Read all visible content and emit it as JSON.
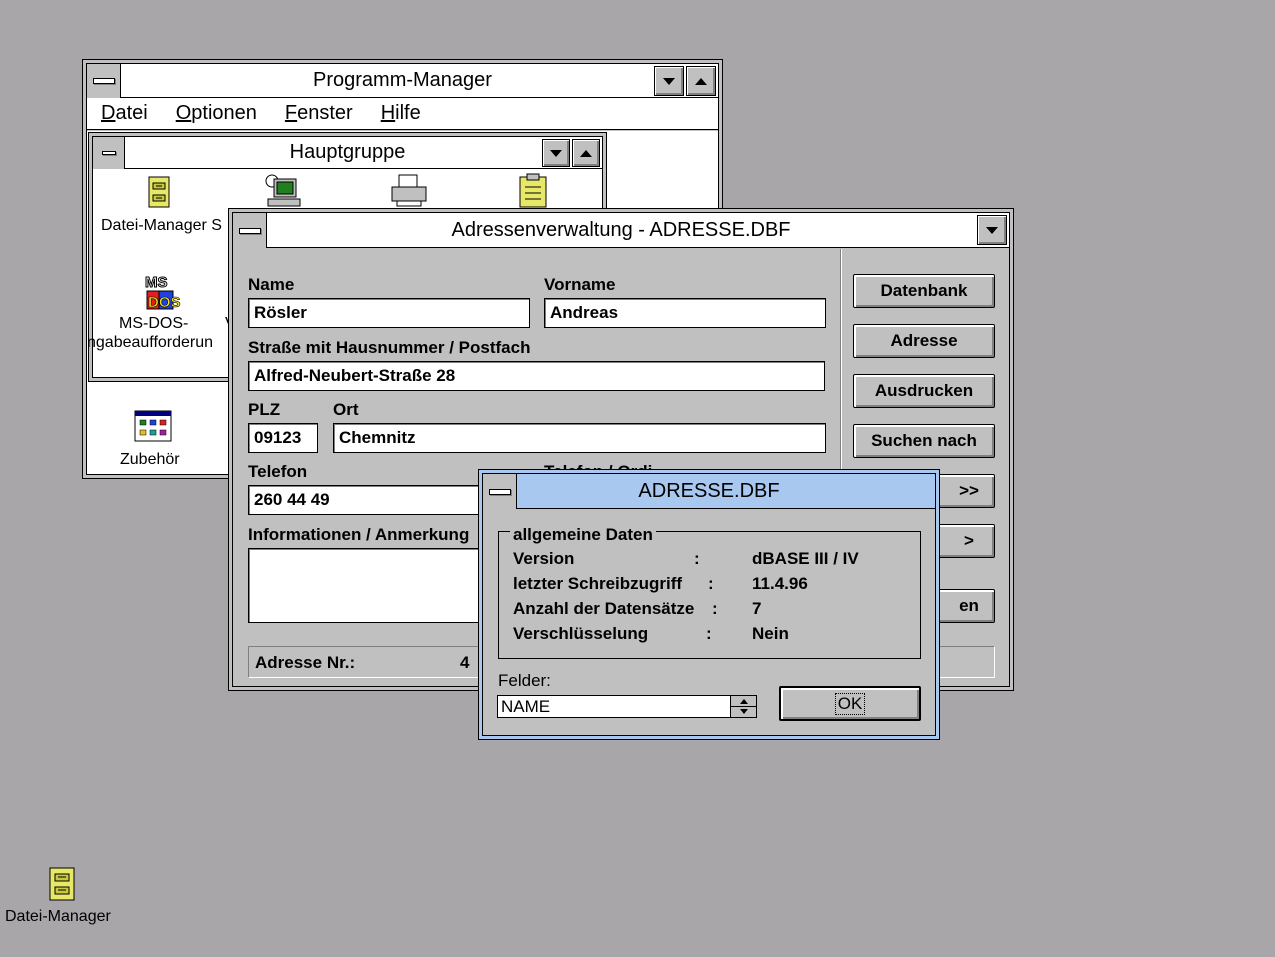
{
  "program_manager": {
    "title": "Programm-Manager",
    "menu": [
      "Datei",
      "Optionen",
      "Fenster",
      "Hilfe"
    ],
    "group_title": "Hauptgruppe",
    "icons": {
      "file_manager": "Datei-Manager S",
      "msdos_line1": "MS-DOS-",
      "msdos_line2": "ngabeaufforderun",
      "msdos_trail": "V",
      "accessories": "Zubehör"
    }
  },
  "address_app": {
    "title": "Adressenverwaltung - ADRESSE.DBF",
    "labels": {
      "name": "Name",
      "vorname": "Vorname",
      "strasse": "Straße mit Hausnummer / Postfach",
      "plz": "PLZ",
      "ort": "Ort",
      "telefon": "Telefon",
      "telefon2": "Telefon / Ordi...",
      "info": "Informationen / Anmerkung",
      "addr_nr": "Adresse Nr.:"
    },
    "values": {
      "name": "Rösler",
      "vorname": "Andreas",
      "strasse": "Alfred-Neubert-Straße 28",
      "plz": "09123",
      "ort": "Chemnitz",
      "telefon": "260 44 49",
      "info": "",
      "addr_nr": "4"
    },
    "buttons": {
      "datenbank": "Datenbank",
      "adresse": "Adresse",
      "ausdrucken": "Ausdrucken",
      "suchen": "Suchen nach",
      "next_fast": ">>",
      "next": ">",
      "beenden_partial": "en"
    }
  },
  "dbf_dialog": {
    "title": "ADRESSE.DBF",
    "group_label": "allgemeine Daten",
    "rows": [
      {
        "key": "Version",
        "sep": ":",
        "value": "dBASE III / IV"
      },
      {
        "key": "letzter Schreibzugriff",
        "sep": ":",
        "value": "11.4.96"
      },
      {
        "key": "Anzahl der Datensätze",
        "sep": ":",
        "value": "7"
      },
      {
        "key": "Verschlüsselung",
        "sep": ":",
        "value": "Nein"
      }
    ],
    "fields_label": "Felder:",
    "fields_selected": "NAME",
    "ok": "OK"
  },
  "desktop": {
    "file_manager_label": "Datei-Manager"
  }
}
